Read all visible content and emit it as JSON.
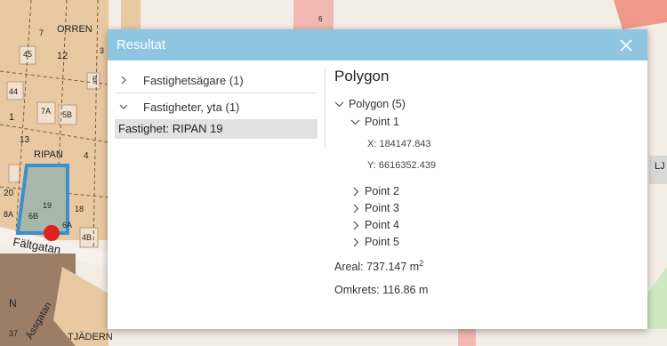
{
  "map": {
    "labels": [
      "ORREN",
      "RIPAN",
      "Fältgatan",
      "TJÄDERN",
      "Ässgatan",
      "LJ",
      "N",
      "45",
      "12",
      "6",
      "44",
      "1",
      "7A",
      "5B",
      "13",
      "4",
      "20",
      "19",
      "18",
      "8A",
      "6B",
      "6A",
      "4B",
      "37",
      "6",
      "7",
      "3"
    ]
  },
  "dialog": {
    "title": "Resultat",
    "left": {
      "groups": [
        {
          "label": "Fastighetsägare (1)",
          "expanded": false
        },
        {
          "label": "Fastigheter, yta (1)",
          "expanded": true
        }
      ],
      "selected_item": "Fastighet: RIPAN 19"
    },
    "right": {
      "title": "Polygon",
      "polygon_label": "Polygon (5)",
      "point1_label": "Point 1",
      "x_text": "X: 184147.843",
      "y_text": "Y: 6616352.439",
      "points_collapsed": [
        "Point 2",
        "Point 3",
        "Point 4",
        "Point 5"
      ],
      "areal_text": "Areal: 737.147 m",
      "areal_sup": "2",
      "omkrets_text": "Omkrets: 116.86 m"
    }
  }
}
